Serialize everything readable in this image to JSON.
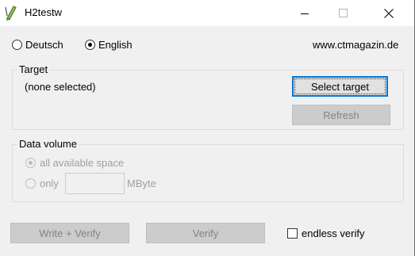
{
  "window": {
    "title": "H2testw",
    "icon": "pencil-icon"
  },
  "controls": {
    "minimize": "minimize-icon",
    "maximize": "maximize-icon",
    "close": "close-icon"
  },
  "language": {
    "options": [
      {
        "label": "Deutsch",
        "selected": false
      },
      {
        "label": "English",
        "selected": true
      }
    ],
    "website": "www.ctmagazin.de"
  },
  "target": {
    "group_title": "Target",
    "selection_text": "(none selected)",
    "select_button": "Select target",
    "refresh_button": "Refresh"
  },
  "data_volume": {
    "group_title": "Data volume",
    "all_space_label": "all available space",
    "all_space_selected": true,
    "only_label": "only",
    "only_selected": false,
    "amount_value": "",
    "unit": "MByte"
  },
  "actions": {
    "write_verify": "Write + Verify",
    "verify": "Verify",
    "endless_verify_label": "endless verify",
    "endless_verify_checked": false
  }
}
